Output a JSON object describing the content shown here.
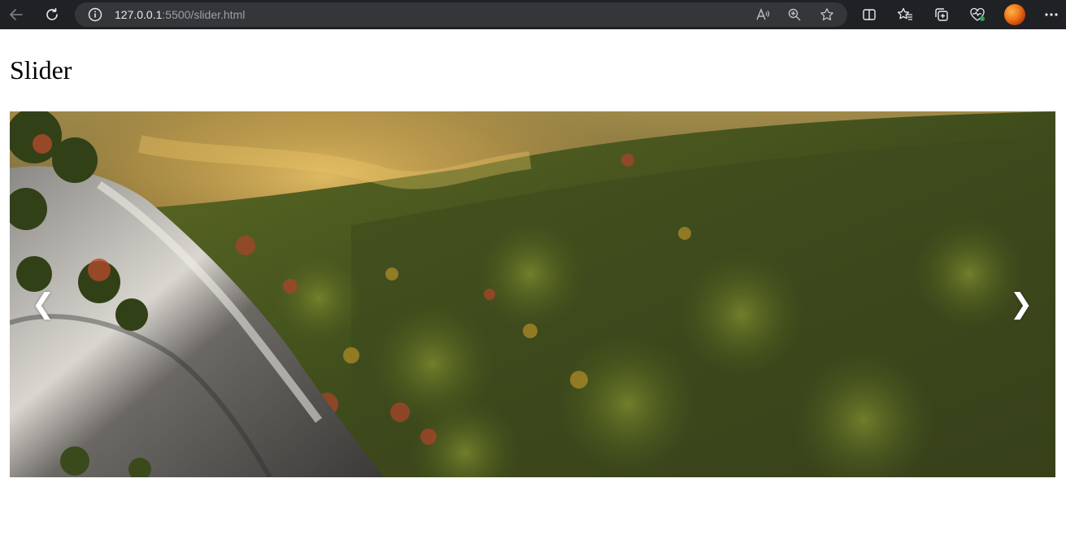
{
  "browser": {
    "url_host": "127.0.0.1",
    "url_rest": ":5500/slider.html",
    "icons": {
      "back": "arrow-left-icon",
      "reload": "reload-icon",
      "info": "info-icon",
      "read_aloud": "read-aloud-icon",
      "zoom": "zoom-in-icon",
      "favorite": "star-icon",
      "split": "split-screen-icon",
      "favorites": "favorites-list-icon",
      "collections": "collections-icon",
      "health": "browser-essentials-icon",
      "menu": "more-menu-icon"
    }
  },
  "page": {
    "title": "Slider"
  },
  "slider": {
    "prev_label": "❮",
    "next_label": "❯",
    "image_description_icon": "landscape-image"
  },
  "colors": {
    "chrome_bg": "#202124",
    "address_bg": "#35363a",
    "page_bg": "#ffffff"
  }
}
